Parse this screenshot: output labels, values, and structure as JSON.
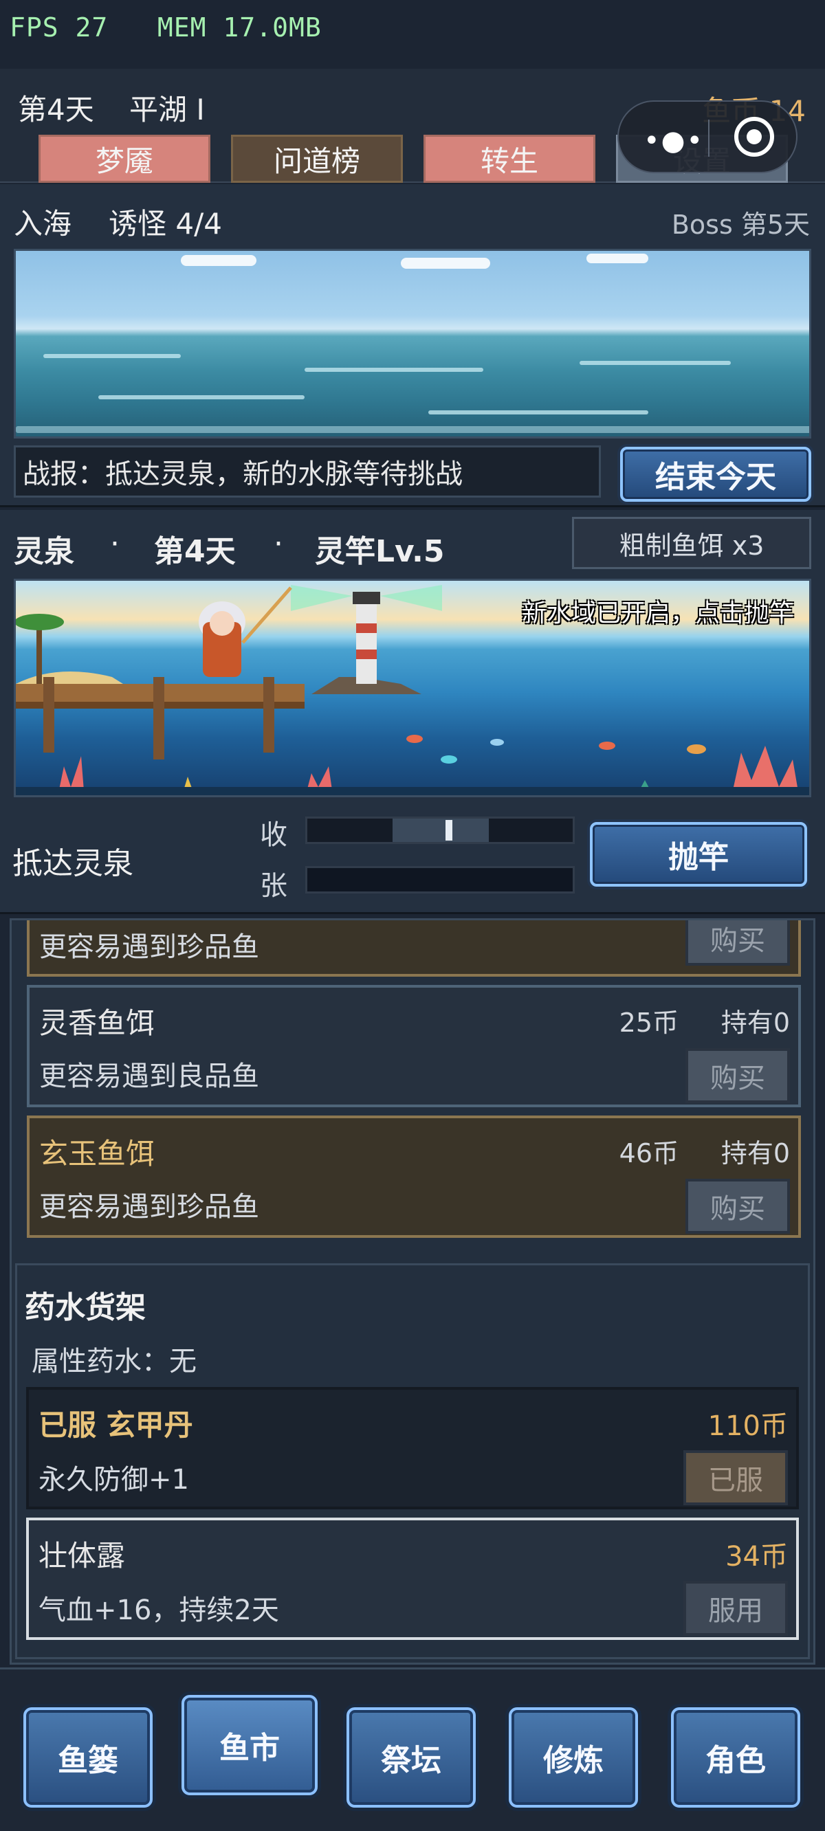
{
  "status": {
    "fps": "FPS 27",
    "mem": "MEM 17.0MB"
  },
  "header": {
    "day": "第4天",
    "area": "平湖 I",
    "coins": "鱼币 14",
    "tabs": [
      {
        "label": "梦魇"
      },
      {
        "label": "问道榜"
      },
      {
        "label": "转生"
      },
      {
        "label": "设置"
      }
    ]
  },
  "sea_panel": {
    "mode": "入海",
    "lure": "诱怪 4/4",
    "boss": "Boss 第5天",
    "report": "战报：抵达灵泉，新的水脉等待挑战",
    "end_day_button": "结束今天"
  },
  "fishing": {
    "location": "灵泉",
    "dot": "·",
    "day": "第4天",
    "rod": "灵竿Lv.5",
    "bait": "粗制鱼饵 x3",
    "scene_message": "新水域已开启，点击抛竿",
    "status": "抵达灵泉",
    "reel_label": "收",
    "tension_label": "张",
    "reel_progress": 0.52,
    "cast_button": "抛竿"
  },
  "shop": {
    "partial_item": {
      "desc": "更容易遇到珍品鱼",
      "button": "购买"
    },
    "items": [
      {
        "name": "灵香鱼饵",
        "price": "25币",
        "owned": "持有0",
        "desc": "更容易遇到良品鱼",
        "button": "购买"
      },
      {
        "name": "玄玉鱼饵",
        "price": "46币",
        "owned": "持有0",
        "desc": "更容易遇到珍品鱼",
        "button": "购买"
      }
    ]
  },
  "potions": {
    "title": "药水货架",
    "attribute": "属性药水：无",
    "items": [
      {
        "name": "已服 玄甲丹",
        "price": "110币",
        "desc": "永久防御+1",
        "button": "已服"
      },
      {
        "name": "壮体露",
        "price": "34币",
        "desc": "气血+16，持续2天",
        "button": "服用"
      }
    ]
  },
  "nav": {
    "items": [
      {
        "label": "鱼篓"
      },
      {
        "label": "鱼市"
      },
      {
        "label": "祭坛"
      },
      {
        "label": "修炼"
      },
      {
        "label": "角色"
      }
    ],
    "active": "鱼市"
  },
  "colors": {
    "accent_blue": "#3f6fa8",
    "gold": "#e4b263",
    "tab_red": "#d6847c"
  }
}
